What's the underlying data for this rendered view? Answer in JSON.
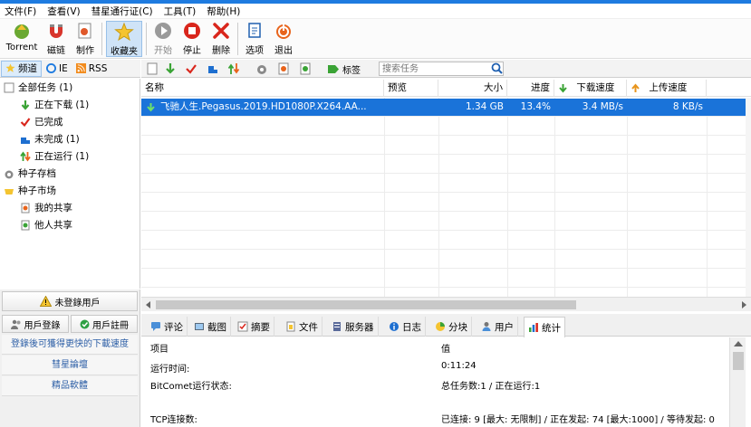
{
  "menu": [
    "文件(F)",
    "查看(V)",
    "彗星通行证(C)",
    "工具(T)",
    "帮助(H)"
  ],
  "toolbar": {
    "torrent": "Torrent",
    "magnet": "磁链",
    "make": "制作",
    "favorites": "收藏夹",
    "start": "开始",
    "stop": "停止",
    "delete": "删除",
    "options": "选项",
    "exit": "退出"
  },
  "left_tabs": {
    "channel": "频道",
    "ie": "IE",
    "rss": "RSS"
  },
  "tree": {
    "all": "全部任务 (1)",
    "downloading": "正在下载 (1)",
    "completed": "已完成",
    "incomplete": "未完成 (1)",
    "running": "正在运行 (1)",
    "torrent_archive": "种子存档",
    "torrent_market": "种子市场",
    "my_share": "我的共享",
    "others_share": "他人共享"
  },
  "left_panel": {
    "not_logged": "未登錄用戶",
    "login": "用戶登錄",
    "register": "用戶註冊",
    "link1": "登錄後可獲得更快的下載速度",
    "link2": "彗星論壇",
    "link3": "精品軟體"
  },
  "list_toolbar": {
    "tag": "标签",
    "search_placeholder": "搜索任务"
  },
  "columns": {
    "name": "名称",
    "preview": "预览",
    "size": "大小",
    "progress": "进度",
    "down_speed": "下载速度",
    "up_speed": "上传速度"
  },
  "tasks": [
    {
      "name": "飞驰人生.Pegasus.2019.HD1080P.X264.AA...",
      "preview": "",
      "size": "1.34 GB",
      "progress": "13.4%",
      "down_speed": "3.4 MB/s",
      "up_speed": "8 KB/s"
    }
  ],
  "detail_tabs": [
    "评论",
    "截图",
    "摘要",
    "文件",
    "服务器",
    "日志",
    "分块",
    "用户",
    "统计"
  ],
  "stats": {
    "header_item": "项目",
    "header_value": "值",
    "runtime_label": "运行时间:",
    "runtime_value": "0:11:24",
    "status_label": "BitComet运行状态:",
    "status_value": "总任务数:1 / 正在运行:1",
    "tcp_label": "TCP连接数:",
    "tcp_value": "已连接: 9 [最大: 无限制] / 正在发起: 74 [最大:1000] / 等待发起: 0"
  },
  "colors": {
    "accent": "#1a73d9",
    "link": "#2d5fa6"
  }
}
